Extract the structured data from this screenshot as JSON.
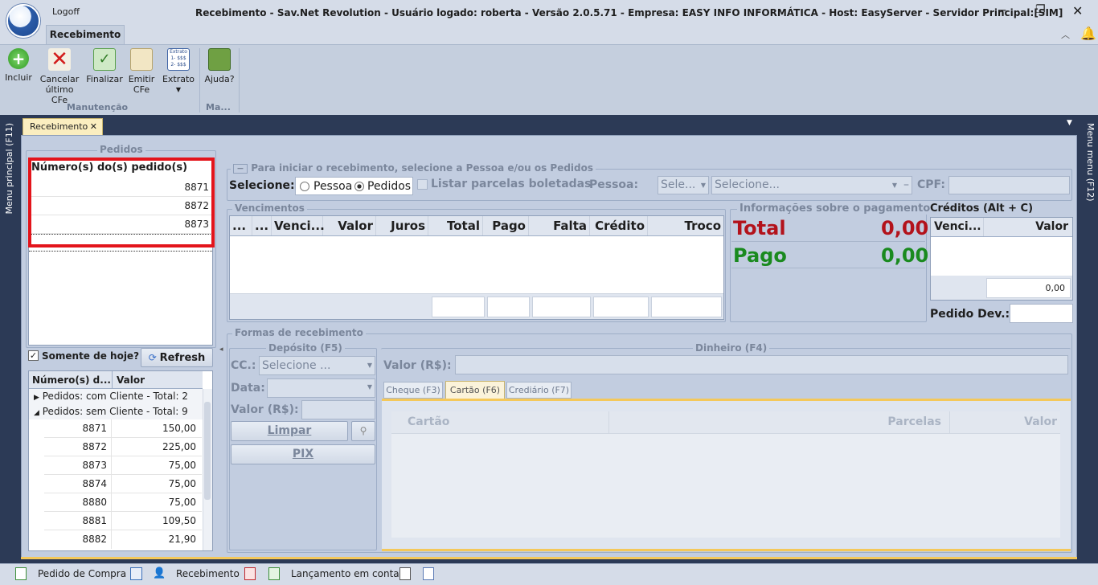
{
  "window": {
    "logoff": "Logoff",
    "title": "Recebimento - Sav.Net Revolution - Usuário logado: roberta - Versão 2.0.5.71 - Empresa: EASY INFO INFORMÁTICA - Host: EasyServer - Servidor Principal:[SIM]"
  },
  "ribbon": {
    "tab": "Recebimento",
    "buttons": [
      "Incluir",
      "Cancelar último CFe",
      "Finalizar",
      "Emitir CFe",
      "Extrato",
      "Ajuda?"
    ],
    "group_manutencao": "Manutenção",
    "group_ma": "Ma..."
  },
  "doc_tab": {
    "label": "Recebimento",
    "close": "✕"
  },
  "side": {
    "left": "Menu principal (F11)",
    "right": "Menu menu (F12)"
  },
  "pedidos": {
    "legend": "Pedidos",
    "header": "Número(s) do(s) pedido(s)",
    "rows": [
      "8871",
      "8872",
      "8873"
    ],
    "somente_hoje": "Somente de hoje?",
    "refresh": "Refresh",
    "grid_cols": [
      "Número(s) d...",
      "Valor"
    ],
    "group1": "Pedidos: com Cliente - Total: 2",
    "group2": "Pedidos: sem Cliente - Total: 9",
    "items": [
      {
        "num": "8871",
        "valor": "150,00"
      },
      {
        "num": "8872",
        "valor": "225,00"
      },
      {
        "num": "8873",
        "valor": "75,00"
      },
      {
        "num": "8874",
        "valor": "75,00"
      },
      {
        "num": "8880",
        "valor": "75,00"
      },
      {
        "num": "8881",
        "valor": "109,50"
      },
      {
        "num": "8882",
        "valor": "21,90"
      }
    ]
  },
  "iniciar": {
    "legend": "Para iniciar o recebimento, selecione a Pessoa e/ou os Pedidos",
    "selecione": "Selecione:",
    "pessoa_radio": "Pessoa",
    "pedidos_radio": "Pedidos",
    "listar": "Listar parcelas boletadas",
    "pessoa_label": "Pessoa:",
    "pessoa_sel": "Sele...",
    "pessoa_sel2": "Selecione...",
    "cpf": "CPF:"
  },
  "venc": {
    "legend": "Vencimentos",
    "cols": [
      "...",
      "...",
      "Venci...",
      "Valor",
      "Juros",
      "Total",
      "Pago",
      "Falta",
      "Crédito",
      "Troco"
    ]
  },
  "info": {
    "legend": "Informações sobre o pagamento",
    "total_label": "Total",
    "total_val": "0,00",
    "pago_label": "Pago",
    "pago_val": "0,00"
  },
  "creditos": {
    "title": "Créditos (Alt + C)",
    "cols": [
      "Venci...",
      "Valor"
    ],
    "sum": "0,00",
    "pedido_dev": "Pedido Dev.:"
  },
  "formas": {
    "legend": "Formas de recebimento",
    "deposito": "Depósito (F5)",
    "cc": "CC.:",
    "cc_sel": "Selecione ...",
    "data": "Data:",
    "valor": "Valor (R$):",
    "limpar": "Limpar",
    "pix": "PIX",
    "dinheiro": "Dinheiro (F4)",
    "din_valor": "Valor (R$):",
    "tabs": [
      "Cheque (F3)",
      "Cartão (F6)",
      "Crediário (F7)"
    ],
    "cartao_cols": [
      "Cartão",
      "Parcelas",
      "Valor"
    ]
  },
  "statusbar": {
    "items": [
      "Pedido de Compra",
      "Recebimento",
      "Lançamento em conta"
    ]
  },
  "colors": {
    "total": "#b3121b",
    "pago": "#1a8a1f",
    "highlight": "#e3141b"
  }
}
